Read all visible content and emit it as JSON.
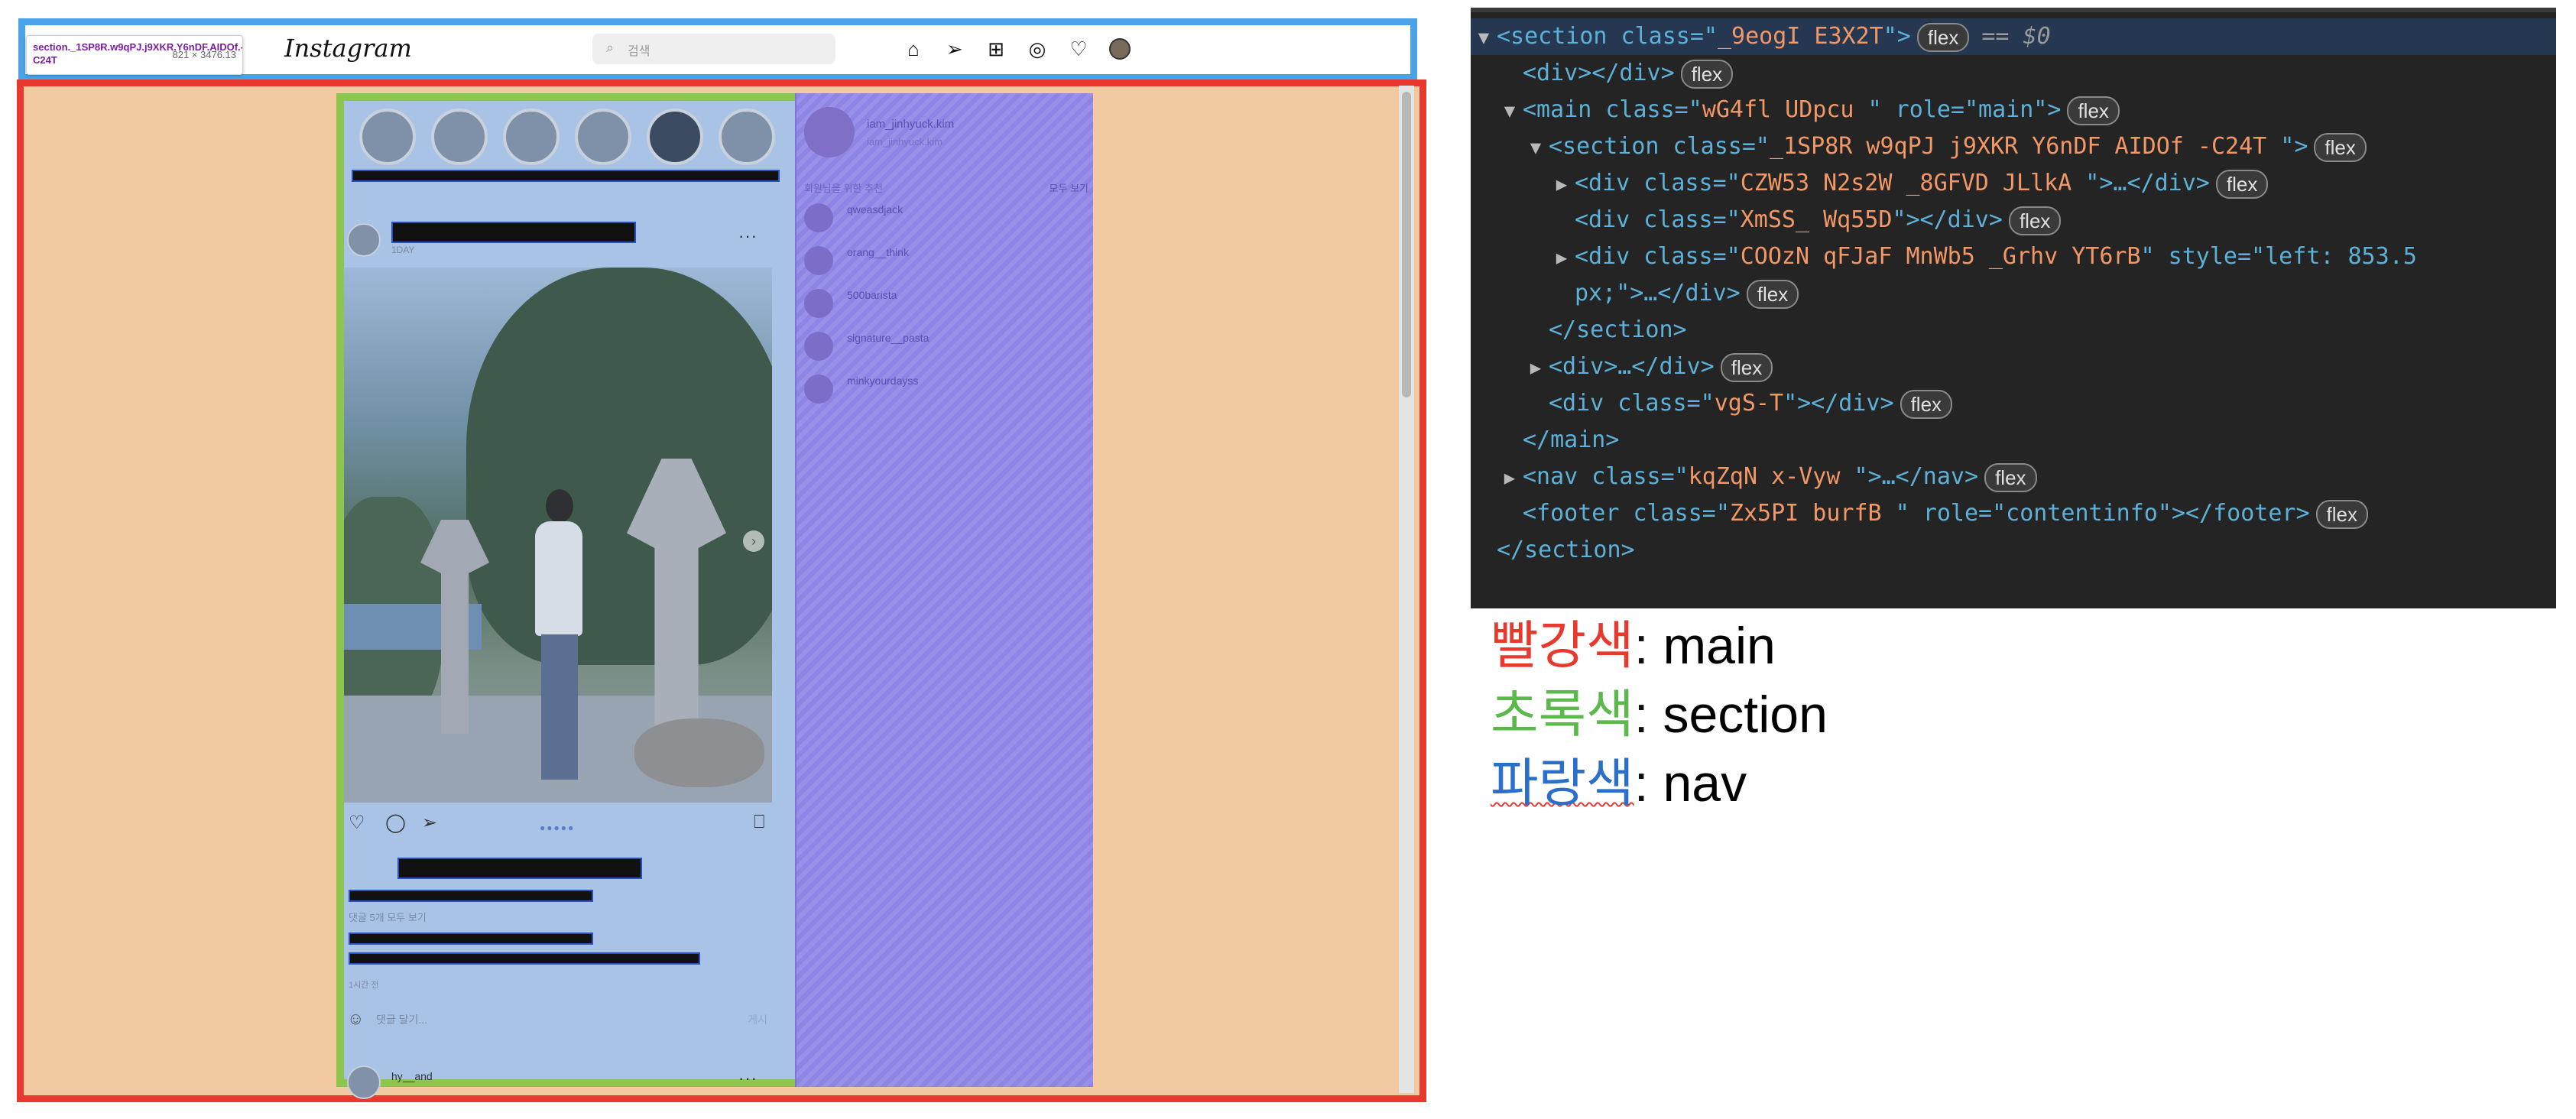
{
  "browser": {
    "devtip": {
      "selector": "section._1SP8R.w9qPJ.j9XKR.Y6nDF.AIDOf.-C24T",
      "size": "821 × 3476.13"
    },
    "logo": "Instagram",
    "search": {
      "placeholder": "검색"
    },
    "nav_icons": [
      "home-icon",
      "direct-icon",
      "new-post-icon",
      "explore-icon",
      "activity-heart-icon",
      "profile-avatar-icon"
    ]
  },
  "feed": {
    "post_time": "1DAY",
    "comments_link": "댓글 5개 모두 보기",
    "post_age": "1시간 전",
    "comment_placeholder": "댓글 달기...",
    "comment_post": "게시",
    "next_user": "hy__and"
  },
  "sidebar": {
    "profile_name": "iam_jinhyuck.kim",
    "profile_sub": "iam_jinhyuck.kim",
    "header": "회원님을 위한 추천",
    "see_all": "모두 보기",
    "suggestions": [
      {
        "name": "qweasdjack"
      },
      {
        "name": "orang__think"
      },
      {
        "name": "500barista"
      },
      {
        "name": "signature__pasta"
      },
      {
        "name": "minkyourdayss"
      }
    ]
  },
  "devtools": {
    "lines": [
      {
        "indent": 0,
        "tri": "▼",
        "open": "<section class=\"",
        "cls": "_9eogI E3X2T",
        "close": "\">",
        "badge": "flex",
        "extra": "== $0",
        "selected": true
      },
      {
        "indent": 1,
        "tri": "",
        "open": "<div>",
        "cls": "",
        "close": "</div>",
        "badge": "flex"
      },
      {
        "indent": 1,
        "tri": "▼",
        "open": "<main class=\"",
        "cls": "wG4fl  UDpcu ",
        "close": "\" role=\"main\">",
        "badge": "flex"
      },
      {
        "indent": 2,
        "tri": "▼",
        "open": "<section class=\"",
        "cls": "_1SP8R w9qPJ j9XKR Y6nDF AIDOf -C24T  ",
        "close": "\">",
        "badge": "flex"
      },
      {
        "indent": 3,
        "tri": "▶",
        "open": "<div class=\"",
        "cls": "CZW53 N2s2W _8GFVD  JLlkA ",
        "close": "\">…</div>",
        "badge": "flex"
      },
      {
        "indent": 3,
        "tri": "",
        "open": "<div class=\"",
        "cls": "XmSS_ Wq55D",
        "close": "\"></div>",
        "badge": "flex"
      },
      {
        "indent": 3,
        "tri": "▶",
        "open": "<div class=\"",
        "cls": "COOzN qFJaF MnWb5 _Grhv YT6rB",
        "close": "\" style=\"left: 853.5",
        "badge": ""
      },
      {
        "indent": 3,
        "tri": "",
        "open": "px;\">…</div>",
        "cls": "",
        "close": "",
        "badge": "flex"
      },
      {
        "indent": 2,
        "tri": "",
        "open": "</section>",
        "cls": "",
        "close": "",
        "badge": ""
      },
      {
        "indent": 2,
        "tri": "▶",
        "open": "<div>…</div>",
        "cls": "",
        "close": "",
        "badge": "flex"
      },
      {
        "indent": 2,
        "tri": "",
        "open": "<div class=\"",
        "cls": "vgS-T",
        "close": "\"></div>",
        "badge": "flex"
      },
      {
        "indent": 1,
        "tri": "",
        "open": "</main>",
        "cls": "",
        "close": "",
        "badge": ""
      },
      {
        "indent": 1,
        "tri": "▶",
        "open": "<nav class=\"",
        "cls": "kqZqN x-Vyw  ",
        "close": "\">…</nav>",
        "badge": "flex"
      },
      {
        "indent": 1,
        "tri": "",
        "open": "<footer class=\"",
        "cls": "Zx5PI  burfB  ",
        "close": "\" role=\"contentinfo\"></footer>",
        "badge": "flex"
      },
      {
        "indent": 0,
        "tri": "",
        "open": "</section>",
        "cls": "",
        "close": "",
        "badge": ""
      }
    ]
  },
  "legend": [
    {
      "color_word": "빨강색",
      "color": "#e8392e",
      "label": "main"
    },
    {
      "color_word": "초록색",
      "color": "#5bb84b",
      "label": "section"
    },
    {
      "color_word": "파랑색",
      "color": "#2a6fc9",
      "label": "nav"
    }
  ],
  "colors": {
    "main_outline": "#e8392e",
    "section_outline": "#8dc64f",
    "nav_outline": "#4aa3e8"
  }
}
